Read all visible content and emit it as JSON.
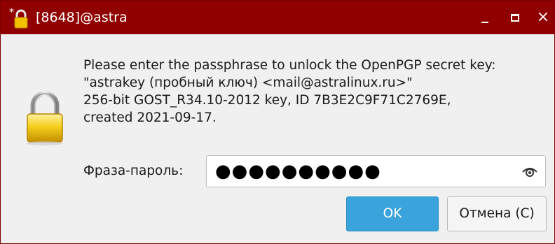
{
  "window": {
    "title": "[8648]@astra",
    "title_icon": "lock-icon",
    "colors": {
      "titlebar": "#900000",
      "accent_button": "#3aa3dc"
    }
  },
  "controls": {
    "minimize": "_",
    "maximize": "□",
    "close": "×"
  },
  "message": {
    "line1": "Please enter the passphrase to unlock the OpenPGP secret key:",
    "line2": "\"astrakey (пробный ключ) <mail@astralinux.ru>\"",
    "line3": "256-bit GOST_R34.10-2012 key, ID 7B3E2C9F71C2769E,",
    "line4": "created 2021-09-17."
  },
  "passphrase": {
    "label": "Фраза-пароль:",
    "masked_value": "●●●●●●●●●●",
    "toggle_icon": "eye-icon"
  },
  "buttons": {
    "ok": "OK",
    "cancel": "Отмена (С)"
  }
}
